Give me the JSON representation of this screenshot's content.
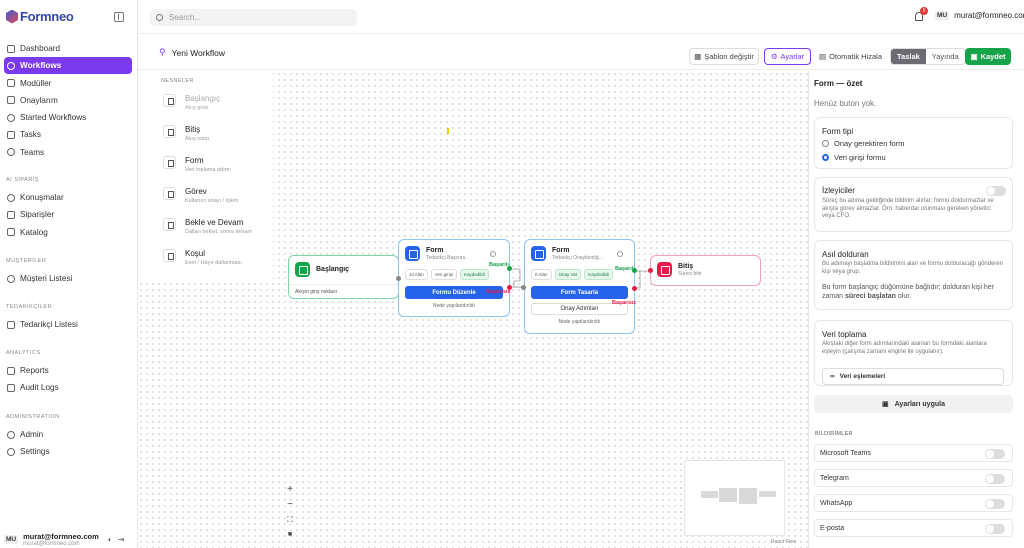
{
  "brand": {
    "logo_text": "Formneo"
  },
  "sidebar": {
    "main": [
      {
        "label": "Dashboard"
      },
      {
        "label": "Workflows"
      },
      {
        "label": "Modüller"
      },
      {
        "label": "Onaylarım"
      },
      {
        "label": "Started Workflows"
      },
      {
        "label": "Tasks"
      },
      {
        "label": "Teams"
      }
    ],
    "sections": [
      {
        "title": "AI SİPARİŞ",
        "items": [
          "Konuşmalar",
          "Siparişler",
          "Katalog"
        ]
      },
      {
        "title": "MÜŞTERİLER",
        "items": [
          "Müşteri Listesi"
        ]
      },
      {
        "title": "TEDARİKÇİLER",
        "items": [
          "Tedarikçi Listesi"
        ]
      },
      {
        "title": "ANALYTICS",
        "items": [
          "Reports",
          "Audit Logs"
        ]
      },
      {
        "title": "ADMINISTRATION",
        "items": [
          "Admin",
          "Settings"
        ]
      }
    ],
    "user": {
      "avatar": "MU",
      "email": "murat@formneo.com",
      "sub": "murat@formneo.com"
    }
  },
  "topbar": {
    "search_placeholder": "Search...",
    "notification_count": "5",
    "avatar": "MU",
    "email": "murat@formneo.com"
  },
  "workflow": {
    "title": "Yeni Workflow",
    "buttons": {
      "template": "Şablon değiştir",
      "settings": "Ayarlar",
      "auto_layout": "Otomatik Hizala",
      "draft": "Taslak",
      "publish": "Yayında",
      "save": "Kaydet"
    }
  },
  "palette": {
    "title": "NESNELER",
    "items": [
      {
        "name": "Başlangıç",
        "desc": "Akış girişi"
      },
      {
        "name": "Bitiş",
        "desc": "Akış sonu"
      },
      {
        "name": "Form",
        "desc": "Veri toplama adımı"
      },
      {
        "name": "Görev",
        "desc": "Kullanıcı onayı / işlem"
      },
      {
        "name": "Bekle ve Devam",
        "desc": "Dalları beklet, sonra devam"
      },
      {
        "name": "Koşul",
        "desc": "Evet / Hayır dallanması"
      }
    ]
  },
  "nodes": {
    "start": {
      "title": "Başlangıç",
      "foot": "Akışın giriş noktası"
    },
    "form1": {
      "title": "Form",
      "sub": "Tedarikçi Başvuru",
      "chips": [
        "1ti Alan",
        "Veri girişi",
        "Kaydedildi"
      ],
      "button": "Formu Düzenle",
      "foot": "Node yapılandırıldı",
      "ok": "Başarılı",
      "fail": "Başarısız"
    },
    "form2": {
      "title": "Form",
      "sub": "Tedarikçi Onaylandığ...",
      "chips": [
        "0 Alan",
        "Onay Var",
        "Kaydedildi"
      ],
      "button": "Form Tasarla",
      "button2": "Onay Adımları",
      "foot": "Node yapılandırıldı",
      "ok": "Başarılı",
      "fail": "Başarısız"
    },
    "end": {
      "title": "Bitiş",
      "sub": "Süreci bitir"
    }
  },
  "canvas": {
    "attribution": "React Flow"
  },
  "panel": {
    "title": "Form — özet",
    "hint": "Henüz buton yok.",
    "form_type": {
      "title": "Form tipi",
      "options": [
        "Onay gerektiren form",
        "Veri girişi formu"
      ],
      "selected": 1
    },
    "watchers": {
      "title": "İzleyiciler",
      "text": "Süreç bu adıma geldiğinde bildirim alırlar; formu doldurmazlar ve akışta görev almazlar. Örn. haberdar olunması gereken yönetici veya CFO."
    },
    "filler": {
      "title": "Asıl dolduran",
      "text": "Bu adımayı başlatma bildirimini alan ve formu dolduracağı gönderen kişi veya grup.",
      "text2a": "Bu form başlangıç düğümüne bağlıdır; dolduran kişi her zaman ",
      "text2b": "süreci başlatan",
      "text2c": " olur."
    },
    "data": {
      "title": "Veri toplama",
      "text": "Akıştaki diğer form adımlarındaki alanları bu formdaki alanlara eşleyin (çalışma zamanı engine ile uygulanır).",
      "button": "Veri eşlemeleri"
    },
    "apply": "Ayarları uygula",
    "notifications": {
      "title": "BİLDİRİMLER",
      "items": [
        "Microsoft Teams",
        "Telegram",
        "WhatsApp",
        "E-posta"
      ]
    }
  },
  "colors": {
    "accent": "#7c3aed",
    "save": "#16a34a",
    "primary": "#2563eb",
    "start": "#16a34a",
    "end": "#e11d48"
  }
}
